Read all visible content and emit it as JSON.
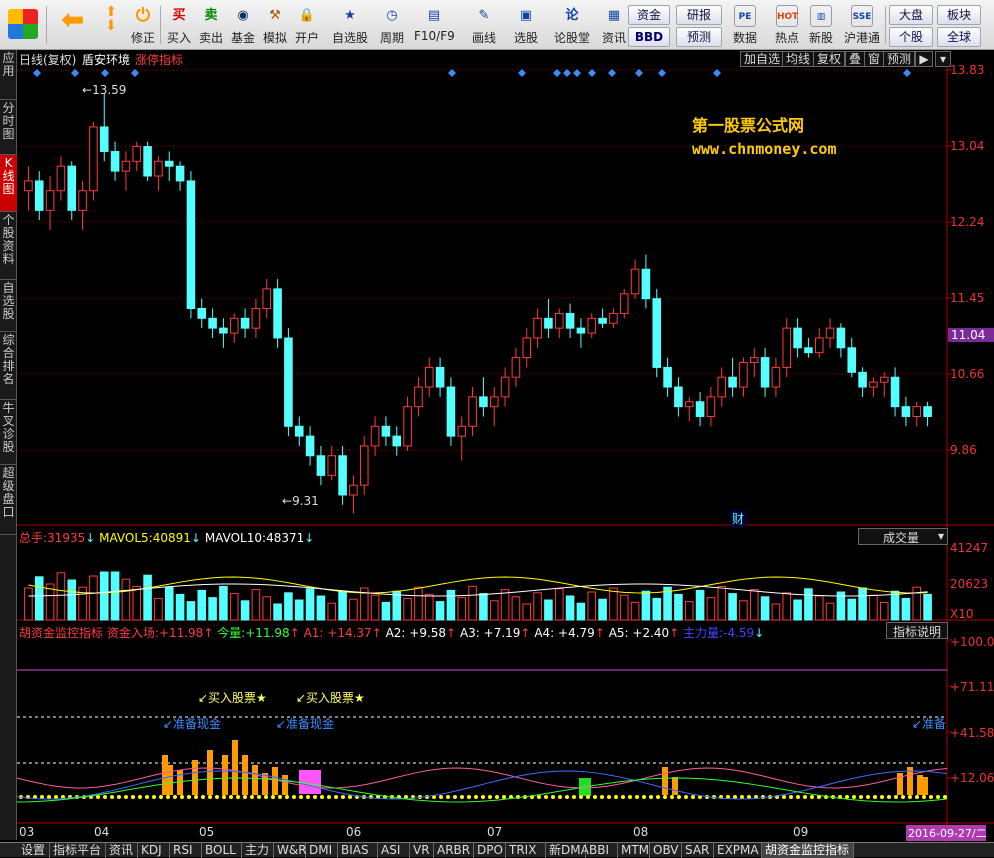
{
  "toolbar": {
    "buttons": [
      {
        "label": "买入",
        "icon": "buy-icon",
        "glyph": "买",
        "color": "#d00"
      },
      {
        "label": "卖出",
        "icon": "sell-icon",
        "glyph": "卖",
        "color": "#080"
      },
      {
        "label": "基金",
        "icon": "fund-icon",
        "glyph": "◉",
        "color": "#036"
      },
      {
        "label": "模拟",
        "icon": "hammer-icon",
        "glyph": "⚒",
        "color": "#a50"
      },
      {
        "label": "开户",
        "icon": "lock-icon",
        "glyph": "🔒",
        "color": "#555"
      },
      {
        "label": "自选股",
        "icon": "star-folder-icon",
        "glyph": "★",
        "color": "#14a"
      },
      {
        "label": "周期",
        "icon": "clock-icon",
        "glyph": "◷",
        "color": "#14a"
      },
      {
        "label": "F10/F9",
        "icon": "doc-icon",
        "glyph": "▤",
        "color": "#14a"
      },
      {
        "label": "画线",
        "icon": "pen-icon",
        "glyph": "✎",
        "color": "#14a"
      },
      {
        "label": "选股",
        "icon": "screen-icon",
        "glyph": "▣",
        "color": "#14a"
      },
      {
        "label": "论股堂",
        "icon": "forum-icon",
        "glyph": "论",
        "color": "#14a"
      },
      {
        "label": "资讯",
        "icon": "news-icon",
        "glyph": "▦",
        "color": "#14a"
      }
    ],
    "small_buttons": [
      "资金",
      "BBD",
      "研报",
      "预测"
    ],
    "buttons2": [
      {
        "label": "数据",
        "icon": "pe-icon",
        "glyph": "PE",
        "color": "#14a"
      },
      {
        "label": "热点",
        "icon": "hot-icon",
        "glyph": "HOT",
        "color": "#d40"
      },
      {
        "label": "新股",
        "icon": "newstock-icon",
        "glyph": "▥",
        "color": "#14a"
      },
      {
        "label": "沪港通",
        "icon": "hkconnect-icon",
        "glyph": "SSE",
        "color": "#14a"
      }
    ],
    "right_buttons": [
      "大盘",
      "板块",
      "个股",
      "全球"
    ]
  },
  "side_tabs": [
    "应用",
    "分时图",
    "K线图",
    "个股资料",
    "自选股",
    "综合排名",
    "牛叉诊股",
    "超级盘口"
  ],
  "header": {
    "kline_label": "日线(复权)",
    "stock_name": "盾安环境",
    "signal_label": "涨停指标",
    "top_buttons": [
      "加自选",
      "均线",
      "复权",
      "叠",
      "窗",
      "预测"
    ]
  },
  "watermark": {
    "line1": "第一股票公式网",
    "line2": "www.chnmoney.com"
  },
  "price_axis": [
    "13.83",
    "13.04",
    "12.24",
    "11.45",
    "10.66",
    "9.86"
  ],
  "current_price": "11.04",
  "annotations": {
    "high": "13.59",
    "low": "9.31",
    "cai": "财"
  },
  "volume_header": {
    "total_label": "总手:",
    "total_value": "31935",
    "mavol5_label": "MAVOL5:",
    "mavol5_value": "40891",
    "mavol10_label": "MAVOL10:",
    "mavol10_value": "48371",
    "dropdown": "成交量"
  },
  "volume_axis": [
    "41247",
    "20623",
    "X10"
  ],
  "indicator_header": {
    "name": "胡资金监控指标",
    "fund_in_label": "资金入场:",
    "fund_in_value": "+11.98",
    "today_label": "今量:",
    "today_value": "+11.98",
    "a1": "A1: +14.37",
    "a2": "A2: +9.58",
    "a3": "A3: +7.19",
    "a4": "A4: +4.79",
    "a5": "A5: +2.40",
    "main_label": "主力量:",
    "main_value": "-4.59",
    "explain_btn": "指标说明"
  },
  "indicator_axis": [
    "+100.0",
    "+71.11",
    "+41.58",
    "+12.06"
  ],
  "indicator_signals": {
    "buy": "↙买入股票★",
    "prepare": "↙准备现金",
    "prepare_short": "↙准备"
  },
  "months": [
    "03",
    "04",
    "05",
    "06",
    "07",
    "08",
    "09"
  ],
  "date_badge": "2016-09-27/二",
  "bottom_tabs": [
    "设置",
    "指标平台",
    "资讯",
    "KDJ",
    "RSI",
    "BOLL",
    "主力",
    "W&R",
    "DMI",
    "BIAS",
    "ASI",
    "VR",
    "ARBR",
    "DPO",
    "TRIX",
    "新DMA",
    "BBI",
    "MTM",
    "OBV",
    "SAR",
    "EXPMA",
    "胡资金监控指标"
  ],
  "colors": {
    "up": "#ff3b3b",
    "down": "#54ffff",
    "axis": "#b00000",
    "text_yellow": "#ffff00"
  },
  "chart_data": {
    "type": "candlestick",
    "ohlc": [
      [
        12.6,
        12.85,
        12.4,
        12.7
      ],
      [
        12.7,
        12.8,
        12.3,
        12.4
      ],
      [
        12.4,
        12.75,
        12.2,
        12.6
      ],
      [
        12.6,
        12.95,
        12.5,
        12.85
      ],
      [
        12.85,
        12.9,
        12.3,
        12.4
      ],
      [
        12.4,
        12.7,
        12.2,
        12.6
      ],
      [
        12.6,
        13.3,
        12.5,
        13.25
      ],
      [
        13.25,
        13.59,
        12.9,
        13.0
      ],
      [
        13.0,
        13.1,
        12.7,
        12.8
      ],
      [
        12.8,
        13.0,
        12.6,
        12.9
      ],
      [
        12.9,
        13.1,
        12.8,
        13.05
      ],
      [
        13.05,
        13.1,
        12.7,
        12.75
      ],
      [
        12.75,
        12.95,
        12.6,
        12.9
      ],
      [
        12.9,
        13.0,
        12.7,
        12.85
      ],
      [
        12.85,
        12.9,
        12.6,
        12.7
      ],
      [
        12.7,
        12.8,
        11.3,
        11.4
      ],
      [
        11.4,
        11.5,
        11.2,
        11.3
      ],
      [
        11.3,
        11.4,
        11.1,
        11.2
      ],
      [
        11.2,
        11.3,
        11.0,
        11.15
      ],
      [
        11.15,
        11.35,
        11.05,
        11.3
      ],
      [
        11.3,
        11.4,
        11.1,
        11.2
      ],
      [
        11.2,
        11.5,
        11.1,
        11.4
      ],
      [
        11.4,
        11.7,
        11.3,
        11.6
      ],
      [
        11.6,
        11.7,
        11.0,
        11.1
      ],
      [
        11.1,
        11.2,
        10.1,
        10.2
      ],
      [
        10.2,
        10.3,
        10.0,
        10.1
      ],
      [
        10.1,
        10.2,
        9.8,
        9.9
      ],
      [
        9.9,
        10.0,
        9.6,
        9.7
      ],
      [
        9.7,
        10.0,
        9.65,
        9.9
      ],
      [
        9.9,
        10.0,
        9.4,
        9.5
      ],
      [
        9.5,
        9.7,
        9.31,
        9.6
      ],
      [
        9.6,
        10.1,
        9.5,
        10.0
      ],
      [
        10.0,
        10.3,
        9.9,
        10.2
      ],
      [
        10.2,
        10.3,
        10.0,
        10.1
      ],
      [
        10.1,
        10.2,
        9.9,
        10.0
      ],
      [
        10.0,
        10.5,
        9.95,
        10.4
      ],
      [
        10.4,
        10.7,
        10.3,
        10.6
      ],
      [
        10.6,
        10.9,
        10.5,
        10.8
      ],
      [
        10.8,
        10.9,
        10.5,
        10.6
      ],
      [
        10.6,
        10.7,
        10.0,
        10.1
      ],
      [
        10.1,
        10.3,
        9.85,
        10.2
      ],
      [
        10.2,
        10.6,
        10.1,
        10.5
      ],
      [
        10.5,
        10.7,
        10.3,
        10.4
      ],
      [
        10.4,
        10.6,
        10.2,
        10.5
      ],
      [
        10.5,
        10.8,
        10.4,
        10.7
      ],
      [
        10.7,
        11.0,
        10.6,
        10.9
      ],
      [
        10.9,
        11.2,
        10.8,
        11.1
      ],
      [
        11.1,
        11.4,
        11.0,
        11.3
      ],
      [
        11.3,
        11.5,
        11.1,
        11.2
      ],
      [
        11.2,
        11.4,
        11.1,
        11.35
      ],
      [
        11.35,
        11.45,
        11.1,
        11.2
      ],
      [
        11.2,
        11.3,
        11.0,
        11.15
      ],
      [
        11.15,
        11.35,
        11.1,
        11.3
      ],
      [
        11.3,
        11.4,
        11.2,
        11.25
      ],
      [
        11.25,
        11.4,
        11.2,
        11.35
      ],
      [
        11.35,
        11.6,
        11.3,
        11.55
      ],
      [
        11.55,
        11.9,
        11.5,
        11.8
      ],
      [
        11.8,
        11.95,
        11.4,
        11.5
      ],
      [
        11.5,
        11.6,
        10.7,
        10.8
      ],
      [
        10.8,
        10.9,
        10.5,
        10.6
      ],
      [
        10.6,
        10.7,
        10.3,
        10.4
      ],
      [
        10.4,
        10.5,
        10.25,
        10.45
      ],
      [
        10.45,
        10.55,
        10.2,
        10.3
      ],
      [
        10.3,
        10.6,
        10.2,
        10.5
      ],
      [
        10.5,
        10.8,
        10.4,
        10.7
      ],
      [
        10.7,
        10.9,
        10.5,
        10.6
      ],
      [
        10.6,
        10.9,
        10.5,
        10.85
      ],
      [
        10.85,
        11.0,
        10.7,
        10.9
      ],
      [
        10.9,
        11.0,
        10.5,
        10.6
      ],
      [
        10.6,
        10.9,
        10.5,
        10.8
      ],
      [
        10.8,
        11.3,
        10.7,
        11.2
      ],
      [
        11.2,
        11.3,
        10.9,
        11.0
      ],
      [
        11.0,
        11.1,
        10.9,
        10.95
      ],
      [
        10.95,
        11.2,
        10.9,
        11.1
      ],
      [
        11.1,
        11.3,
        11.0,
        11.2
      ],
      [
        11.2,
        11.25,
        10.9,
        11.0
      ],
      [
        11.0,
        11.1,
        10.7,
        10.75
      ],
      [
        10.75,
        10.8,
        10.5,
        10.6
      ],
      [
        10.6,
        10.7,
        10.5,
        10.65
      ],
      [
        10.65,
        10.75,
        10.5,
        10.7
      ],
      [
        10.7,
        10.8,
        10.3,
        10.4
      ],
      [
        10.4,
        10.5,
        10.2,
        10.3
      ],
      [
        10.3,
        10.45,
        10.2,
        10.4
      ],
      [
        10.4,
        10.45,
        10.2,
        10.3
      ]
    ],
    "price_ylim": [
      9.5,
      13.83
    ]
  }
}
